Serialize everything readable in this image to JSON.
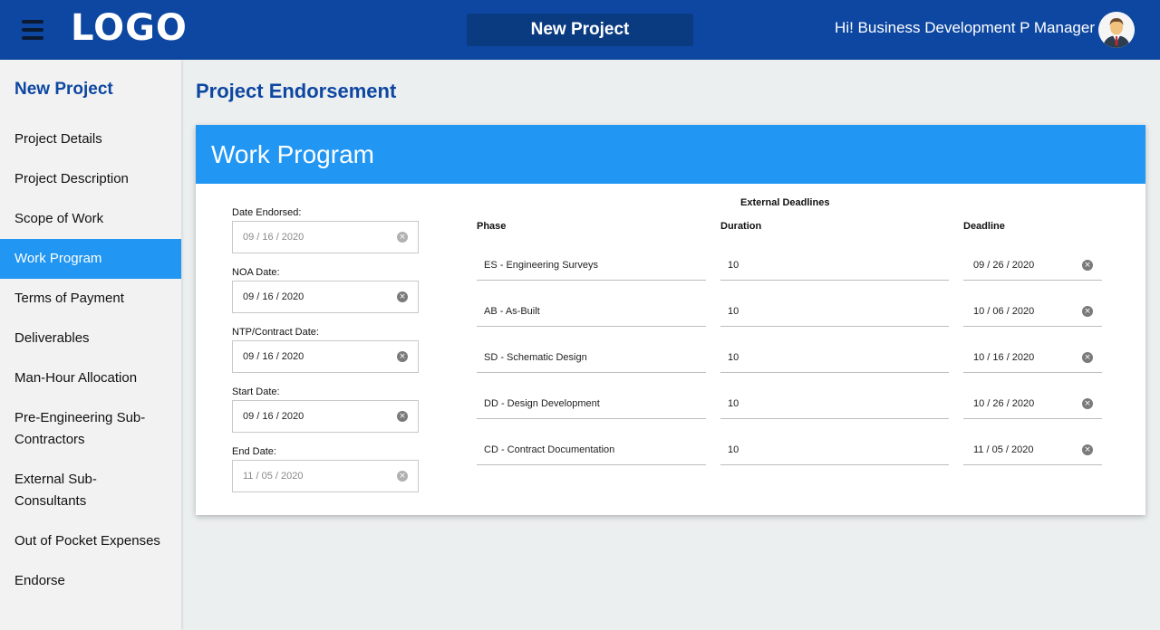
{
  "header": {
    "logo": "LOGO",
    "title": "New Project",
    "greeting": "Hi! Business Development P Manager"
  },
  "sidebar": {
    "title": "New Project",
    "items": [
      {
        "label": "Project Details"
      },
      {
        "label": "Project Description"
      },
      {
        "label": "Scope of Work"
      },
      {
        "label": "Work Program",
        "active": true
      },
      {
        "label": "Terms of Payment"
      },
      {
        "label": "Deliverables"
      },
      {
        "label": "Man-Hour Allocation"
      },
      {
        "label": "Pre-Engineering Sub-Contractors"
      },
      {
        "label": "External Sub-Consultants"
      },
      {
        "label": "Out of Pocket Expenses"
      },
      {
        "label": "Endorse"
      }
    ]
  },
  "main": {
    "page_title": "Project Endorsement",
    "card_title": "Work Program",
    "dates": [
      {
        "label": "Date Endorsed:",
        "value": "09 / 16 / 2020",
        "disabled": true
      },
      {
        "label": "NOA Date:",
        "value": "09 / 16 / 2020",
        "disabled": false
      },
      {
        "label": "NTP/Contract Date:",
        "value": "09 / 16 / 2020",
        "disabled": false
      },
      {
        "label": "Start Date:",
        "value": "09 / 16 / 2020",
        "disabled": false
      },
      {
        "label": "End Date:",
        "value": "11 / 05 / 2020",
        "disabled": true
      }
    ],
    "external_deadlines": {
      "title": "External Deadlines",
      "columns": [
        "Phase",
        "Duration",
        "Deadline"
      ],
      "rows": [
        {
          "phase": "ES - Engineering Surveys",
          "duration": "10",
          "deadline": "09 / 26 / 2020"
        },
        {
          "phase": "AB - As-Built",
          "duration": "10",
          "deadline": "10 / 06 / 2020"
        },
        {
          "phase": "SD - Schematic Design",
          "duration": "10",
          "deadline": "10 / 16 / 2020"
        },
        {
          "phase": "DD - Design Development",
          "duration": "10",
          "deadline": "10 / 26 / 2020"
        },
        {
          "phase": "CD - Contract Documentation",
          "duration": "10",
          "deadline": "11 / 05 / 2020"
        }
      ]
    }
  },
  "icons": {
    "menu": "hamburger-icon",
    "clear": "clear-icon",
    "user": "avatar-icon"
  },
  "colors": {
    "header": "#0d47a1",
    "accent": "#2196f3",
    "title": "#0d47a1"
  }
}
